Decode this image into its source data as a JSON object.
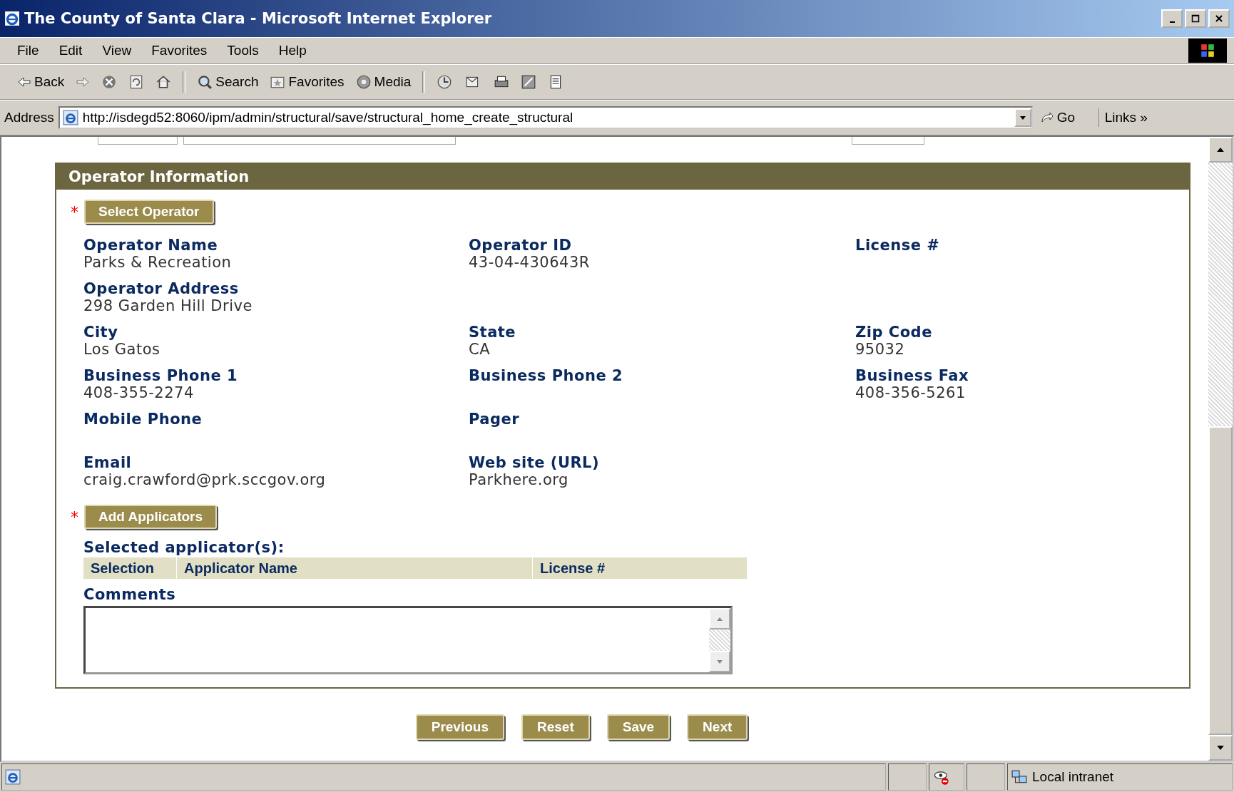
{
  "window": {
    "title": "The County of Santa Clara - Microsoft Internet Explorer"
  },
  "menu": [
    "File",
    "Edit",
    "View",
    "Favorites",
    "Tools",
    "Help"
  ],
  "toolbar": [
    {
      "kind": "back",
      "label": "Back"
    },
    {
      "kind": "forward"
    },
    {
      "kind": "stop"
    },
    {
      "kind": "refresh"
    },
    {
      "kind": "home"
    },
    {
      "kind": "search",
      "label": "Search"
    },
    {
      "kind": "favorites",
      "label": "Favorites"
    },
    {
      "kind": "media",
      "label": "Media"
    },
    {
      "kind": "history"
    },
    {
      "kind": "mail"
    },
    {
      "kind": "print"
    },
    {
      "kind": "edit"
    },
    {
      "kind": "discuss"
    }
  ],
  "address": {
    "label": "Address",
    "value": "http://isdegd52:8060/ipm/admin/structural/save/structural_home_create_structural",
    "go": "Go",
    "links": "Links",
    "links_chevron": "»"
  },
  "section": {
    "title": "Operator Information",
    "required_mark": "*",
    "select_button": "Select Operator",
    "field_rows": [
      [
        {
          "label": "Operator Name",
          "value": "Parks & Recreation"
        },
        {
          "label": "Operator ID",
          "value": "43-04-430643R"
        },
        {
          "label": "License #"
        }
      ],
      [
        {
          "label": "Operator Address",
          "value": "298 Garden Hill Drive"
        }
      ],
      [
        {
          "label": "City",
          "value": "Los Gatos"
        },
        {
          "label": "State",
          "value": "CA"
        },
        {
          "label": "Zip Code",
          "value": "95032"
        }
      ],
      [
        {
          "label": "Business Phone 1",
          "value": "408-355-2274"
        },
        {
          "label": "Business Phone 2"
        },
        {
          "label": "Business Fax",
          "value": "408-356-5261"
        }
      ],
      [
        {
          "label": "Mobile Phone"
        },
        {
          "label": "Pager"
        }
      ],
      [
        {
          "label": "Email",
          "value": "craig.crawford@prk.sccgov.org"
        },
        {
          "label": "Web site (URL)",
          "value": "Parkhere.org"
        }
      ]
    ],
    "add_button": "Add Applicators",
    "applicators_heading": "Selected applicator(s):",
    "applicator_table": {
      "columns": [
        "Selection",
        "Applicator Name",
        "License #"
      ]
    },
    "comments_label": "Comments"
  },
  "buttons": [
    "Previous",
    "Reset",
    "Save",
    "Next"
  ],
  "status_bar": {
    "zone": "Local intranet"
  }
}
